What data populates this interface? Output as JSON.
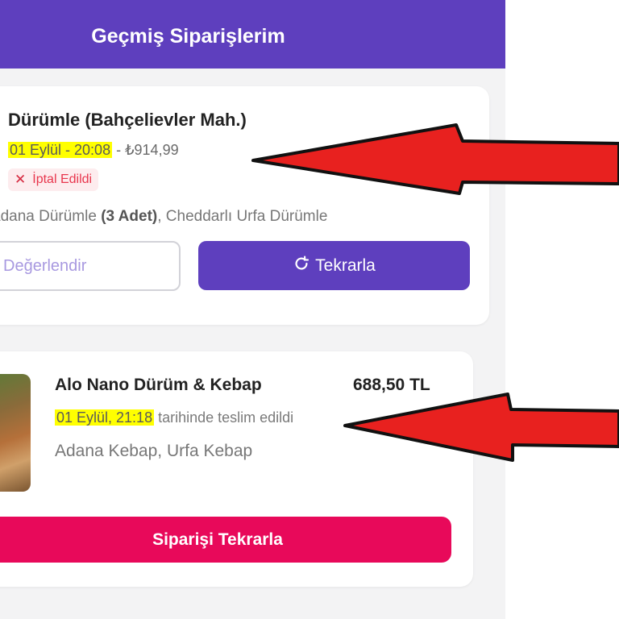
{
  "header": {
    "title": "Geçmiş Siparişlerim"
  },
  "orders": [
    {
      "restaurant": "Dürümle (Bahçelievler Mah.)",
      "date_time": "01 Eylül - 20:08",
      "separator": " - ",
      "amount": "₺914,99",
      "status": "İptal Edildi",
      "items_prefix": "adana Dürümle ",
      "items_qty": "(3 Adet)",
      "items_rest": ", Cheddarlı Urfa Dürümle",
      "rate_label": "Değerlendir",
      "repeat_label": "Tekrarla"
    },
    {
      "restaurant": "Alo Nano Dürüm & Kebap",
      "price": "688,50 TL",
      "date_time": "01 Eylül, 21:18",
      "delivered_suffix": " tarihinde teslim edildi",
      "items": "Adana Kebap, Urfa Kebap",
      "reorder_label": "Siparişi Tekrarla"
    }
  ],
  "annotations": {
    "arrow_color": "#e8211f",
    "highlight_color": "#ffff00"
  },
  "colors": {
    "brand_purple": "#5e3fbe",
    "reorder_pink": "#e8095a",
    "cancel_red": "#e8364d"
  }
}
